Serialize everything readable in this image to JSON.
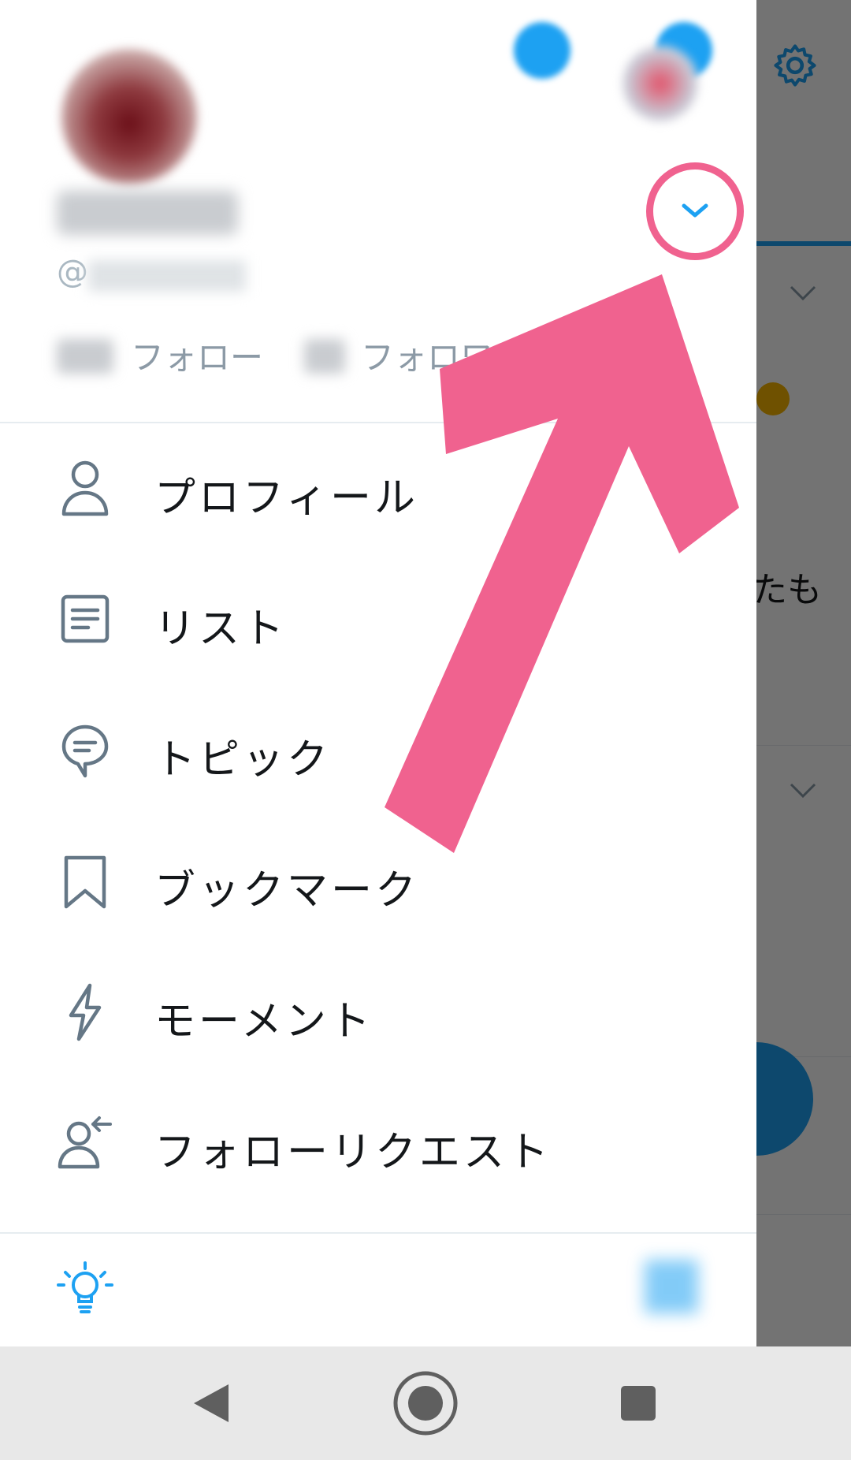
{
  "background": {
    "partial_text": "たも",
    "accent_color": "#1da1f2"
  },
  "drawer": {
    "handle_prefix": "@",
    "following_label": "フォロー",
    "followers_label": "フォロワー",
    "expand_icon": "chevron-down-icon",
    "menu": [
      {
        "icon": "person-icon",
        "label": "プロフィール"
      },
      {
        "icon": "list-icon",
        "label": "リスト"
      },
      {
        "icon": "topic-bubble-icon",
        "label": "トピック"
      },
      {
        "icon": "bookmark-icon",
        "label": "ブックマーク"
      },
      {
        "icon": "lightning-icon",
        "label": "モーメント"
      },
      {
        "icon": "follow-request-icon",
        "label": "フォローリクエスト"
      }
    ],
    "footer": {
      "left_icon": "lightbulb-icon",
      "right_icon": "qr-code-icon"
    }
  },
  "annotation": {
    "color": "#f0628f"
  },
  "navbar": {
    "buttons": [
      "back-icon",
      "home-icon",
      "recents-icon"
    ]
  }
}
